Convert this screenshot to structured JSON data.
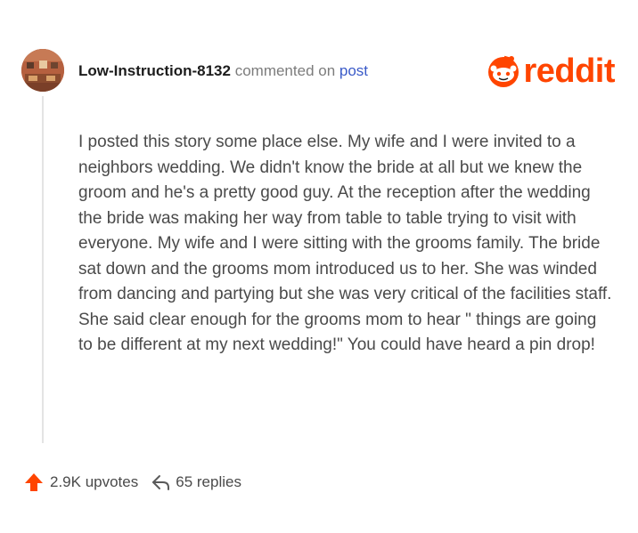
{
  "comment": {
    "username": "Low-Instruction-8132",
    "action_text": "commented on",
    "post_link": "post",
    "body": "I posted this story some place else. My wife and I were invited to a neighbors wedding. We didn't know the bride at all but we knew the groom and he's a pretty good guy. At the reception after the wedding the bride was making her way from table to table trying to visit with everyone. My wife and I were sitting with the grooms family. The bride sat down and the grooms mom introduced us to her. She was winded from dancing and partying but she was very critical of the facilities staff. She said clear enough for the grooms mom to hear \" things are going to be different at my next wedding!\" You could have heard a pin drop!",
    "upvotes": "2.9K upvotes",
    "replies": "65 replies"
  },
  "brand": {
    "name": "reddit",
    "color": "#ff4500",
    "icon": "reddit-snoo-icon"
  },
  "icons": {
    "upvote": "arrow-up-icon",
    "reply": "reply-arrow-icon"
  },
  "colors": {
    "accent": "#ff4500",
    "link": "#3a5ac8",
    "text": "#4a4a4a"
  }
}
